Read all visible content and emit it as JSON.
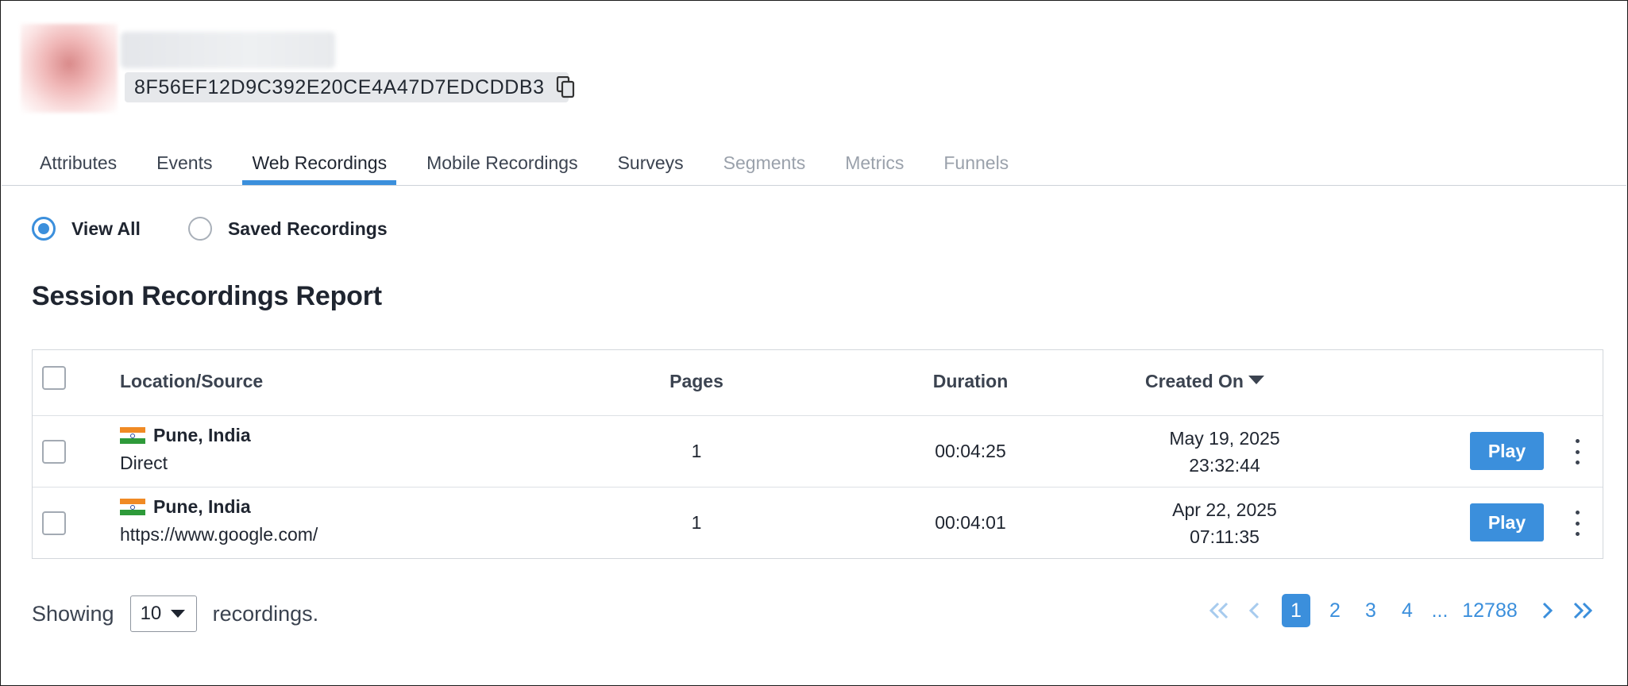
{
  "profile": {
    "id": "8F56EF12D9C392E20CE4A47D7EDCDDB3"
  },
  "tabs": [
    {
      "label": "Attributes",
      "state": "normal"
    },
    {
      "label": "Events",
      "state": "normal"
    },
    {
      "label": "Web Recordings",
      "state": "active"
    },
    {
      "label": "Mobile Recordings",
      "state": "normal"
    },
    {
      "label": "Surveys",
      "state": "normal"
    },
    {
      "label": "Segments",
      "state": "disabled"
    },
    {
      "label": "Metrics",
      "state": "disabled"
    },
    {
      "label": "Funnels",
      "state": "disabled"
    }
  ],
  "filter": {
    "options": [
      {
        "label": "View All",
        "checked": true
      },
      {
        "label": "Saved Recordings",
        "checked": false
      }
    ]
  },
  "report": {
    "title": "Session Recordings Report",
    "columns": {
      "location": "Location/Source",
      "pages": "Pages",
      "duration": "Duration",
      "created": "Created On"
    },
    "rows": [
      {
        "city": "Pune, India",
        "source": "Direct",
        "pages": "1",
        "duration": "00:04:25",
        "date": "May 19, 2025",
        "time": "23:32:44",
        "action": "Play"
      },
      {
        "city": "Pune, India",
        "source": "https://www.google.com/",
        "pages": "1",
        "duration": "00:04:01",
        "date": "Apr 22, 2025",
        "time": "07:11:35",
        "action": "Play"
      }
    ]
  },
  "footer": {
    "showing_label": "Showing",
    "page_size": "10",
    "suffix": "recordings.",
    "pages": [
      "1",
      "2",
      "3",
      "4",
      "...",
      "12788"
    ],
    "current_page": "1"
  },
  "colors": {
    "accent": "#3b8fdc",
    "disabled_text": "#9aa1ab"
  }
}
